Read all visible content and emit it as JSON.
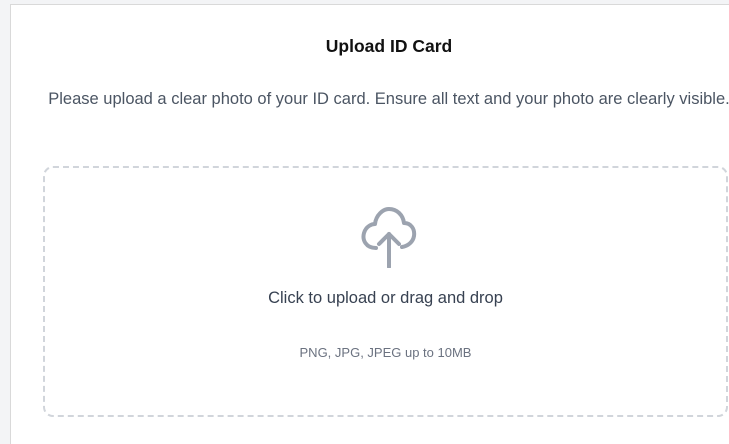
{
  "dialog": {
    "title": "Upload ID Card",
    "description": "Please upload a clear photo of your ID card. Ensure all text and your photo are clearly visible."
  },
  "dropzone": {
    "icon": "cloud-upload-icon",
    "prompt": "Click to upload or drag and drop",
    "hint": "PNG, JPG, JPEG up to 10MB",
    "icon_color": "#9ca3af",
    "border_color": "#d1d5db"
  }
}
